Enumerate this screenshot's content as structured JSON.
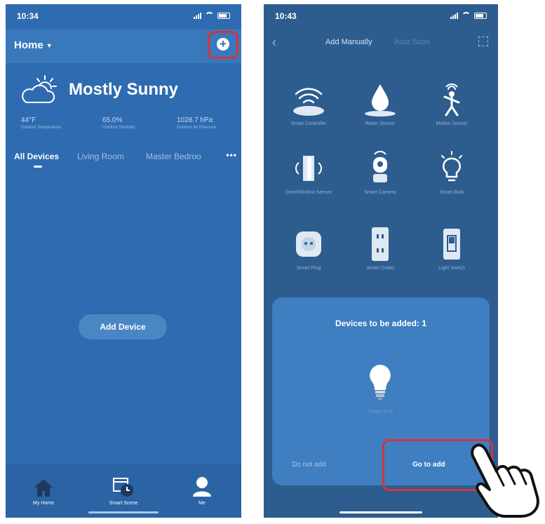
{
  "colors": {
    "accent_red": "#d8323c",
    "phone1_bg": "#2f6bb0",
    "phone2_bg": "#2d5d8f",
    "sheet_bg": "#3f7ec0"
  },
  "phone1": {
    "status_time": "10:34",
    "header": {
      "home_label": "Home",
      "add_icon": "plus-circle-icon"
    },
    "weather": {
      "title": "Mostly Sunny",
      "icon": "cloud-sun-icon",
      "stats": [
        {
          "value": "44°F",
          "label": "Outdoor Temperature"
        },
        {
          "value": "65.0%",
          "label": "Outdoor Humidity"
        },
        {
          "value": "1028.7 hPa",
          "label": "Outdoor Air Pressure"
        }
      ]
    },
    "tabs": {
      "all": "All Devices",
      "living": "Living Room",
      "master": "Master Bedroo",
      "more": "•••"
    },
    "add_device_label": "Add Device",
    "tabbar": {
      "home": "My Home",
      "scene": "Smart Scene",
      "me": "Me"
    }
  },
  "phone2": {
    "status_time": "10:43",
    "nav": {
      "add_manually": "Add Manually",
      "auto_scan": "Auto Scan"
    },
    "devices": [
      {
        "label": "Smart Controller",
        "icon": "controller-icon"
      },
      {
        "label": "Water Sensor",
        "icon": "water-drop-icon"
      },
      {
        "label": "Motion Sensor",
        "icon": "motion-sensor-icon"
      },
      {
        "label": "Door/Window Sensor",
        "icon": "door-sensor-icon"
      },
      {
        "label": "Smart Camera",
        "icon": "camera-icon"
      },
      {
        "label": "Smart Bulb",
        "icon": "bulb-icon"
      },
      {
        "label": "Smart Plug",
        "icon": "plug-icon"
      },
      {
        "label": "Smart Outlet",
        "icon": "outlet-icon"
      },
      {
        "label": "Light Switch",
        "icon": "switch-icon"
      }
    ],
    "sheet": {
      "title": "Devices to be added: 1",
      "device_name": "Smart Bulb",
      "do_not_add": "Do not add",
      "go_to_add": "Go to add"
    }
  }
}
